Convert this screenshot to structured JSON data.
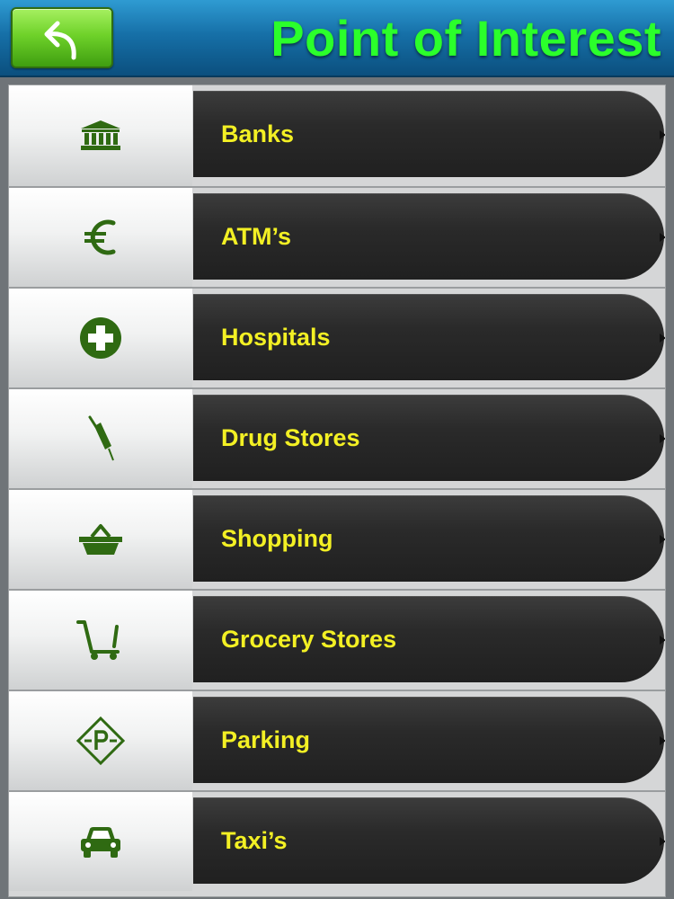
{
  "header": {
    "title": "Point of Interest",
    "back_icon": "back-arrow-icon",
    "title_color": "#2bff2b",
    "bar_color": "#1670a8",
    "back_button_color": "#6fd22a"
  },
  "list": {
    "label_color": "#f3f024",
    "icon_color": "#2f6a12",
    "items": [
      {
        "label": "Banks",
        "icon": "bank-icon"
      },
      {
        "label": "ATM’s",
        "icon": "euro-icon"
      },
      {
        "label": "Hospitals",
        "icon": "medical-cross-icon"
      },
      {
        "label": "Drug Stores",
        "icon": "syringe-icon"
      },
      {
        "label": "Shopping",
        "icon": "basket-icon"
      },
      {
        "label": "Grocery Stores",
        "icon": "shopping-cart-icon"
      },
      {
        "label": "Parking",
        "icon": "parking-sign-icon"
      },
      {
        "label": "Taxi’s",
        "icon": "car-icon"
      }
    ]
  }
}
